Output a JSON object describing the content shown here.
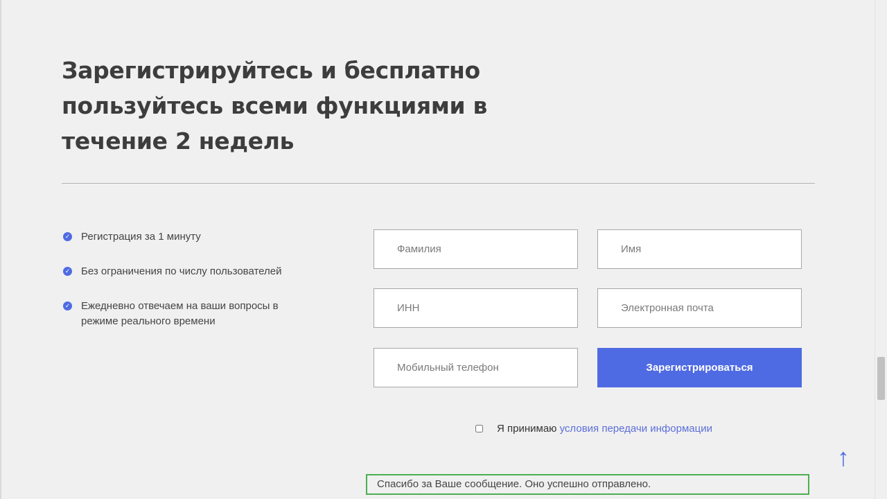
{
  "heading": "Зарегистрируйтесь и бесплатно пользуйтесь всеми функциями в течение 2 недель",
  "features": [
    "Регистрация за 1 минуту",
    "Без ограничения по числу пользователей",
    "Ежедневно отвечаем на ваши вопросы в режиме реального времени"
  ],
  "form": {
    "surname_placeholder": "Фамилия",
    "name_placeholder": "Имя",
    "inn_placeholder": "ИНН",
    "email_placeholder": "Электронная почта",
    "phone_placeholder": "Мобильный телефон",
    "submit_label": "Зарегистрироваться",
    "consent_prefix": "Я принимаю",
    "consent_link": "условия передачи информации",
    "consent_checked": false
  },
  "success_message": "Спасибо за Ваше сообщение. Оно успешно отправлено.",
  "icons": {
    "check": "check-circle-icon",
    "to_top": "arrow-up-icon"
  },
  "colors": {
    "accent": "#4f6be3",
    "success_border": "#4caf50",
    "background": "#f0f0f0"
  }
}
